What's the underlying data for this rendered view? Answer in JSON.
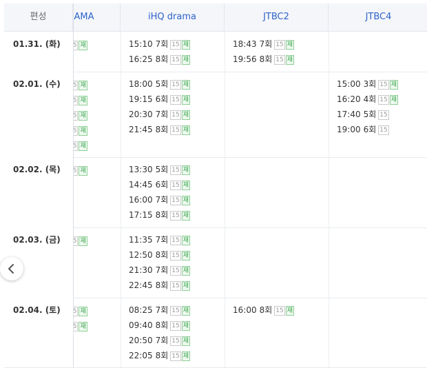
{
  "header": {
    "date_col": "편성",
    "channels": [
      "LAMA",
      "iHQ drama",
      "JTBC2",
      "JTBC4"
    ]
  },
  "badges": {
    "rating": "15",
    "rerun": "재"
  },
  "rows": [
    {
      "date": "01.31. (화)",
      "partial": 1,
      "ihq": [
        {
          "t": "15:10",
          "ep": "7회",
          "re": true
        },
        {
          "t": "16:25",
          "ep": "8회",
          "re": true
        }
      ],
      "jtbc2": [
        {
          "t": "18:43",
          "ep": "7회",
          "re": true
        },
        {
          "t": "19:56",
          "ep": "8회",
          "re": true
        }
      ],
      "jtbc4": []
    },
    {
      "date": "02.01. (수)",
      "partial": 5,
      "ihq": [
        {
          "t": "18:00",
          "ep": "5회",
          "re": true
        },
        {
          "t": "19:15",
          "ep": "6회",
          "re": true
        },
        {
          "t": "20:30",
          "ep": "7회",
          "re": true
        },
        {
          "t": "21:45",
          "ep": "8회",
          "re": true
        }
      ],
      "jtbc2": [],
      "jtbc4": [
        {
          "t": "15:00",
          "ep": "3회",
          "re": true
        },
        {
          "t": "16:20",
          "ep": "4회",
          "re": true
        },
        {
          "t": "17:40",
          "ep": "5회",
          "re": false
        },
        {
          "t": "19:00",
          "ep": "6회",
          "re": false
        }
      ]
    },
    {
      "date": "02.02. (목)",
      "partial": 1,
      "ihq": [
        {
          "t": "13:30",
          "ep": "5회",
          "re": true
        },
        {
          "t": "14:45",
          "ep": "6회",
          "re": true
        },
        {
          "t": "16:00",
          "ep": "7회",
          "re": true
        },
        {
          "t": "17:15",
          "ep": "8회",
          "re": true
        }
      ],
      "jtbc2": [],
      "jtbc4": []
    },
    {
      "date": "02.03. (금)",
      "partial": 1,
      "ihq": [
        {
          "t": "11:35",
          "ep": "7회",
          "re": true
        },
        {
          "t": "12:50",
          "ep": "8회",
          "re": true
        },
        {
          "t": "21:30",
          "ep": "7회",
          "re": true
        },
        {
          "t": "22:45",
          "ep": "8회",
          "re": true
        }
      ],
      "jtbc2": [],
      "jtbc4": []
    },
    {
      "date": "02.04. (토)",
      "partial": 2,
      "ihq": [
        {
          "t": "08:25",
          "ep": "7회",
          "re": true
        },
        {
          "t": "09:40",
          "ep": "8회",
          "re": true
        },
        {
          "t": "20:50",
          "ep": "7회",
          "re": true
        },
        {
          "t": "22:05",
          "ep": "8회",
          "re": true
        }
      ],
      "jtbc2": [
        {
          "t": "16:00",
          "ep": "8회",
          "re": true
        }
      ],
      "jtbc4": []
    }
  ],
  "nav": {
    "prev_icon": "chevron-left-icon"
  }
}
